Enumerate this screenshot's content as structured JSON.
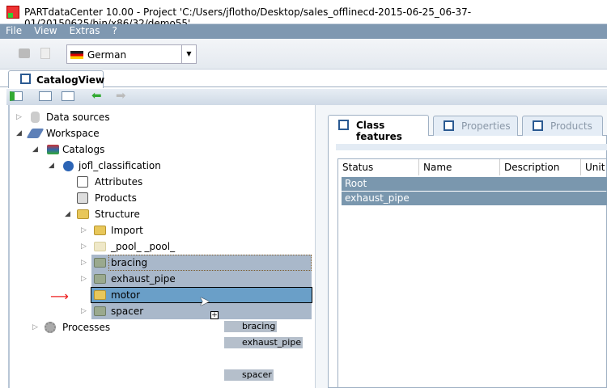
{
  "window": {
    "title": "PARTdataCenter 10.00 - Project 'C:/Users/jflotho/Desktop/sales_offlinecd-2015-06-25_06-37-01/20150625/bin/x86/32/demo55'"
  },
  "menu": [
    "File",
    "View",
    "Extras",
    "?"
  ],
  "toolbar": {
    "language": "German"
  },
  "tabs": {
    "catalog_view": "CatalogView"
  },
  "tree": {
    "data_sources": "Data sources",
    "workspace": "Workspace",
    "catalogs": "Catalogs",
    "catalog": "jofl_classification",
    "attributes": "Attributes",
    "products": "Products",
    "structure": "Structure",
    "children": [
      "Import",
      "_pool_ _pool_",
      "bracing",
      "exhaust_pipe",
      "motor",
      "spacer"
    ],
    "processes": "Processes"
  },
  "drag": {
    "items": [
      "bracing",
      "exhaust_pipe",
      "spacer"
    ]
  },
  "right": {
    "tabs": [
      "Class features",
      "Properties",
      "Products"
    ],
    "columns": [
      "Status",
      "Name",
      "Description",
      "Unit"
    ],
    "rows": [
      "Root",
      "exhaust_pipe"
    ]
  },
  "colors": {
    "menubar": "#7f98b1",
    "selection": "#6a9fc8",
    "multi_selection": "#a9b8ca"
  }
}
